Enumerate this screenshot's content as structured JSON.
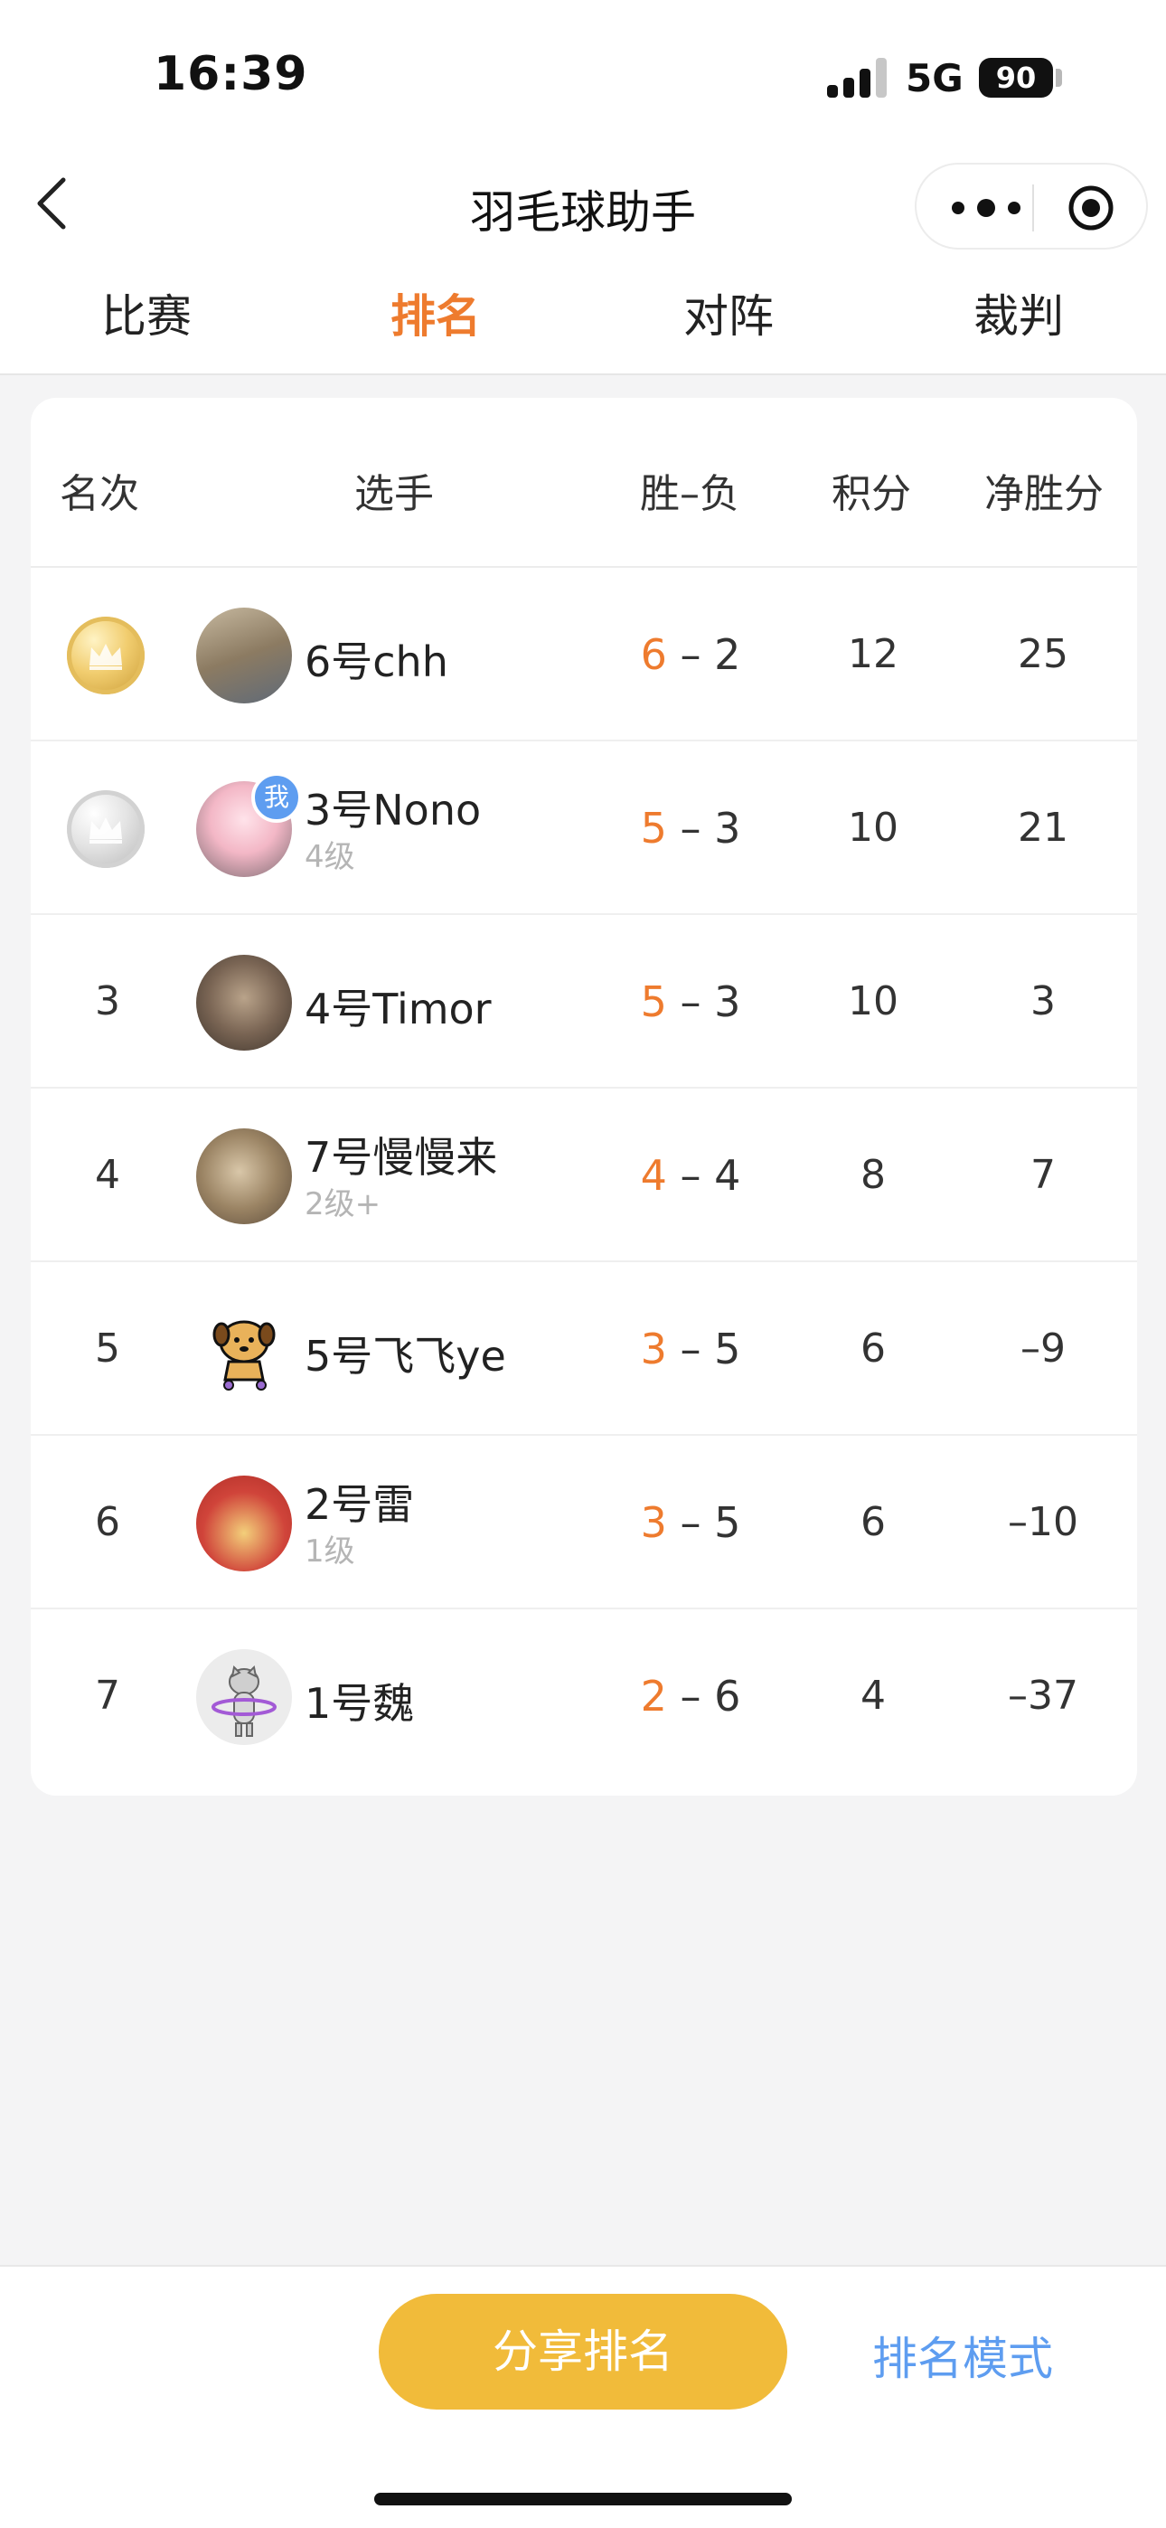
{
  "status_bar": {
    "time": "16:39",
    "network": "5G",
    "battery": "90"
  },
  "nav": {
    "title": "羽毛球助手"
  },
  "tabs": [
    {
      "label": "比赛",
      "active": false
    },
    {
      "label": "排名",
      "active": true
    },
    {
      "label": "对阵",
      "active": false
    },
    {
      "label": "裁判",
      "active": false
    }
  ],
  "table": {
    "headers": {
      "rank": "名次",
      "player": "选手",
      "wl": "胜–负",
      "points": "积分",
      "net": "净胜分"
    },
    "rows": [
      {
        "rank": "1",
        "medal": "gold",
        "name": "6号chh",
        "level": "",
        "wins": "6",
        "losses": "2",
        "points": "12",
        "net": "25",
        "me": false
      },
      {
        "rank": "2",
        "medal": "silver",
        "name": "3号Nono",
        "level": "4级",
        "wins": "5",
        "losses": "3",
        "points": "10",
        "net": "21",
        "me": true
      },
      {
        "rank": "3",
        "medal": "",
        "name": "4号Timor",
        "level": "",
        "wins": "5",
        "losses": "3",
        "points": "10",
        "net": "3",
        "me": false
      },
      {
        "rank": "4",
        "medal": "",
        "name": "7号慢慢来",
        "level": "2级+",
        "wins": "4",
        "losses": "4",
        "points": "8",
        "net": "7",
        "me": false
      },
      {
        "rank": "5",
        "medal": "",
        "name": "5号飞飞ye",
        "level": "",
        "wins": "3",
        "losses": "5",
        "points": "6",
        "net": "–9",
        "me": false
      },
      {
        "rank": "6",
        "medal": "",
        "name": "2号雷",
        "level": "1级",
        "wins": "3",
        "losses": "5",
        "points": "6",
        "net": "–10",
        "me": false
      },
      {
        "rank": "7",
        "medal": "",
        "name": "1号魏",
        "level": "",
        "wins": "2",
        "losses": "6",
        "points": "4",
        "net": "–37",
        "me": false
      }
    ],
    "me_badge": "我",
    "wl_separator": "–"
  },
  "bottom": {
    "share_label": "分享排名",
    "mode_label": "排名模式"
  },
  "colors": {
    "accent_orange": "#ee7b2e",
    "share_yellow": "#f1bb3a",
    "link_blue": "#5e9df0"
  }
}
